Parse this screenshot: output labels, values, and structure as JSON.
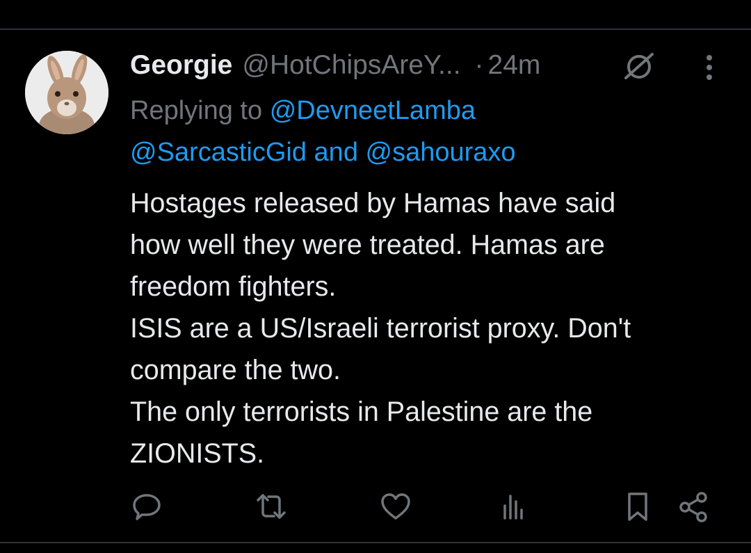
{
  "tweet": {
    "display_name": "Georgie",
    "handle": "@HotChipsAreY...",
    "separator": "·",
    "time": "24m",
    "replying": {
      "prefix": "Replying to",
      "mention1": "@DevneetLamba",
      "mention2": "@SarcasticGid",
      "conjunction": "and",
      "mention3": "@sahouraxo"
    },
    "body_lines": [
      "Hostages released by Hamas have said",
      "how well they were treated. Hamas are",
      "freedom fighters.",
      "ISIS are a US/Israeli terrorist proxy. Don't",
      "compare the two.",
      "The only terrorists in Palestine are the",
      "ZIONISTS."
    ],
    "icons": {
      "audience": "globe-slash-icon",
      "menu": "more-vertical-icon",
      "avatar": "rabbit-avatar"
    }
  },
  "actions": [
    {
      "name": "reply-icon"
    },
    {
      "name": "retweet-icon"
    },
    {
      "name": "like-icon"
    },
    {
      "name": "views-icon"
    },
    {
      "name": "bookmark-icon"
    },
    {
      "name": "share-icon"
    }
  ],
  "colors": {
    "background": "#000000",
    "text": "#e7e9ea",
    "muted": "#71767b",
    "link": "#1d9bf0",
    "divider": "#2f3336"
  }
}
